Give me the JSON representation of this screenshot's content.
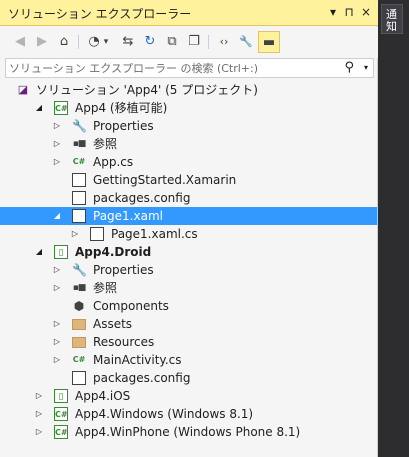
{
  "title": "ソリューション エクスプローラー",
  "title_buttons": {
    "dropdown_icon": "▾",
    "pin_icon": "⊓",
    "close_icon": "×"
  },
  "toolbar": {
    "back_icon": "◀",
    "forward_icon": "▶",
    "home_icon": "⌂",
    "history_icon": "◔",
    "history_dropdown": "▾",
    "sync_icon": "⇆",
    "refresh_icon": "↻",
    "collapse_icon": "⧉",
    "copy_icon": "❐",
    "code_icon": "‹›",
    "properties_icon": "🔧",
    "pin_preview_icon": "▬"
  },
  "search": {
    "placeholder": "ソリューション エクスプローラー の検索 (Ctrl+:)",
    "icon": "⚲",
    "dropdown": "▾"
  },
  "tree": [
    {
      "label": "ソリューション 'App4' (5 プロジェクト)",
      "expander": "",
      "icon": "sln",
      "glyph": "◪",
      "bold": false
    },
    {
      "label": "App4 (移植可能)",
      "expander": "◢",
      "icon": "proj",
      "glyph": "C#",
      "bold": false
    },
    {
      "label": "Properties",
      "expander": "▷",
      "icon": "wrench",
      "glyph": "🔧",
      "bold": false
    },
    {
      "label": "参照",
      "expander": "▷",
      "icon": "ref",
      "glyph": "▪■",
      "bold": false
    },
    {
      "label": "App.cs",
      "expander": "▷",
      "icon": "cs",
      "glyph": "C#",
      "bold": false
    },
    {
      "label": "GettingStarted.Xamarin",
      "expander": "",
      "icon": "file",
      "glyph": "",
      "bold": false
    },
    {
      "label": "packages.config",
      "expander": "",
      "icon": "file",
      "glyph": "",
      "bold": false
    },
    {
      "label": "Page1.xaml",
      "expander": "◢",
      "icon": "file",
      "glyph": "",
      "bold": false,
      "selected": true
    },
    {
      "label": "Page1.xaml.cs",
      "expander": "▷",
      "icon": "file",
      "glyph": "",
      "bold": false
    },
    {
      "label": "App4.Droid",
      "expander": "◢",
      "icon": "droid",
      "glyph": "▯",
      "bold": true
    },
    {
      "label": "Properties",
      "expander": "▷",
      "icon": "wrench",
      "glyph": "🔧",
      "bold": false
    },
    {
      "label": "参照",
      "expander": "▷",
      "icon": "ref",
      "glyph": "▪■",
      "bold": false
    },
    {
      "label": "Components",
      "expander": "",
      "icon": "comp",
      "glyph": "⬢",
      "bold": false
    },
    {
      "label": "Assets",
      "expander": "▷",
      "icon": "folder",
      "glyph": "",
      "bold": false
    },
    {
      "label": "Resources",
      "expander": "▷",
      "icon": "folder",
      "glyph": "",
      "bold": false
    },
    {
      "label": "MainActivity.cs",
      "expander": "▷",
      "icon": "cs",
      "glyph": "C#",
      "bold": false
    },
    {
      "label": "packages.config",
      "expander": "",
      "icon": "file",
      "glyph": "",
      "bold": false
    },
    {
      "label": "App4.iOS",
      "expander": "▷",
      "icon": "droid",
      "glyph": "▯",
      "bold": false
    },
    {
      "label": "App4.Windows (Windows 8.1)",
      "expander": "▷",
      "icon": "proj",
      "glyph": "C#",
      "bold": false
    },
    {
      "label": "App4.WinPhone (Windows Phone 8.1)",
      "expander": "▷",
      "icon": "proj",
      "glyph": "C#",
      "bold": false
    }
  ],
  "side_tab": {
    "label": "通知"
  },
  "colors": {
    "accent_title": "#fff29d",
    "selection": "#3399ff",
    "panel_bg": "#f5f5f5",
    "dark_bg": "#2d2d30"
  }
}
